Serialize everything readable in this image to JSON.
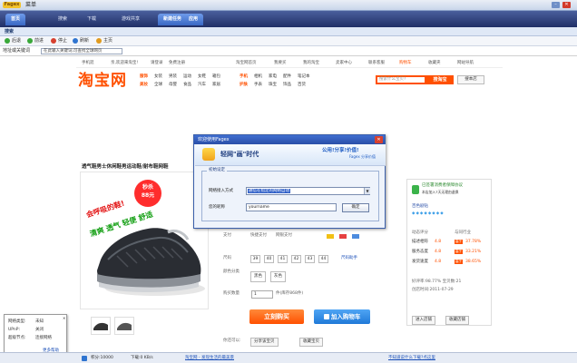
{
  "app": {
    "title": "菜单",
    "logo": "Fagex",
    "nav_tabs": [
      "首页",
      "搜索",
      "下载",
      "游戏共享",
      "新建任务",
      "应用"
    ],
    "browse_label": "搜索",
    "toolbar": [
      "后退",
      "前进",
      "停止",
      "刷新",
      "主页"
    ],
    "address_label": "地址或关键词",
    "address_value": "在此输入关键词,可查找全球网页"
  },
  "site_top": {
    "items": [
      "手机逛",
      "亲,欢迎来淘宝!",
      "请登录",
      "免费注册",
      "淘宝网首页",
      "我要买",
      "我的淘宝",
      "卖家中心",
      "联系客服",
      "购物车",
      "收藏夹",
      "网站导航"
    ]
  },
  "taobao": {
    "logo": "淘宝网",
    "categories_row1": [
      "服饰",
      "女装",
      "男装",
      "运动",
      "女鞋",
      "箱包",
      "手机",
      "相机",
      "家电",
      "配件",
      "笔记本"
    ],
    "categories_row2": [
      "美妆",
      "全球",
      "母婴",
      "食品",
      "汽车",
      "家居",
      "护肤",
      "手表",
      "珠宝",
      "饰品",
      "百货"
    ],
    "search_placeholder": "搜索什么宝贝?",
    "search_button": "搜淘宝",
    "advanced_button": "搜本店"
  },
  "product": {
    "title": "透气鞋男士休闲鞋男运动鞋/耐布鞋网鞋",
    "badge_title": "秒杀",
    "badge_price": "88元",
    "promo_line1": "会呼吸的鞋!",
    "promo_line2": "清爽 透气 轻便 舒适",
    "labels": {
      "payment": "支付",
      "size": "尺码",
      "color": "颜色分类",
      "qty": "购买数量"
    },
    "payment_methods": [
      "快捷支付",
      "网银支付"
    ],
    "sizes": [
      "39",
      "40",
      "41",
      "42",
      "43",
      "44"
    ],
    "size_help": "尺码助手",
    "colors": [
      "黑色",
      "灰色"
    ],
    "qty": "1",
    "stock": "件(库存868件)",
    "buy_now": "立刻购买",
    "add_cart": "加入购物车",
    "share_label": "你还可以:",
    "share_buttons": [
      "分享该宝贝",
      "收藏宝贝"
    ]
  },
  "seller": {
    "protection": "已签署消费者保障协议",
    "protection_sub": "本店加入7天无理由退换",
    "credit_label": "百色剧钻",
    "rating_header": [
      "动态评分",
      "与同行业"
    ],
    "ratings": [
      {
        "name": "描述相符",
        "score": "4.8",
        "trend": "高于",
        "pct": "37.78%"
      },
      {
        "name": "服务态度",
        "score": "4.8",
        "trend": "高于",
        "pct": "33.21%"
      },
      {
        "name": "发货速度",
        "score": "4.8",
        "trend": "高于",
        "pct": "38.65%"
      }
    ],
    "good_rate": "好评率:98.77% 宝贝数:21",
    "open_date": "创店时间:2011-07-29",
    "buttons": [
      "进入店铺",
      "收藏店铺"
    ]
  },
  "dialog": {
    "title": "欢迎使用Fagex",
    "banner_title": "轻网\"画\"时代",
    "slogan": "公用!分享!价值!",
    "slogan_sub": "Fagex 分享价值",
    "group_title": "初始设定",
    "access_label": "网络接入方式",
    "access_value": "通信在指定的网络自动",
    "nick_label": "您的昵称",
    "nick_value": "yourname",
    "ok_button": "确定"
  },
  "network_popup": {
    "rows": [
      {
        "k": "网络类型:",
        "v": "未知"
      },
      {
        "k": "UPnP:",
        "v": "关闭"
      },
      {
        "k": "超级节点:",
        "v": "连接网络"
      }
    ],
    "more": "更多帮助"
  },
  "status": {
    "points": "积分:10000",
    "download": "下载:0 KB/s",
    "link1": "淘宝网 - 发现生活的最美景",
    "link2": "不知道说什么下载?点这里"
  }
}
